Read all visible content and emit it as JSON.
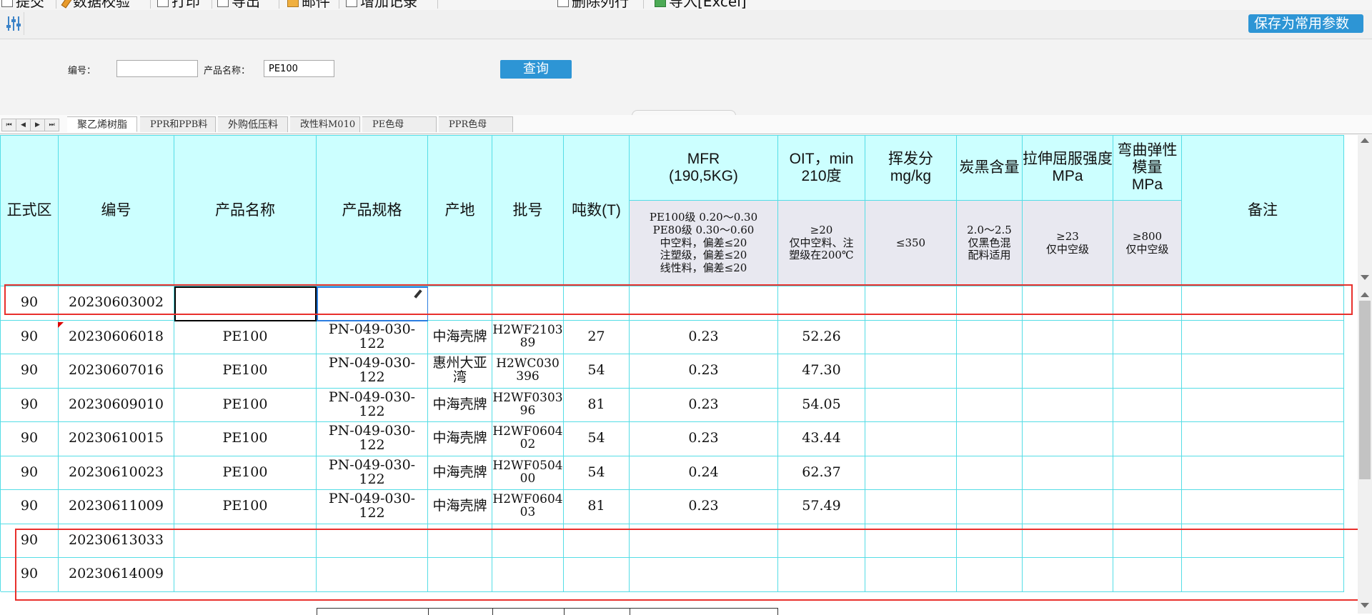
{
  "menubar": {
    "items": [
      "提交",
      "数据校验",
      "打印",
      "导出",
      "邮件",
      "增加记录",
      "删除列行",
      "导入[Excel]"
    ]
  },
  "toolbar": {
    "save_label": "保存为常用参数"
  },
  "search": {
    "code_label": "编号：",
    "code_value": "",
    "name_label": "产品名称：",
    "name_value": "PE100",
    "query_label": "查询"
  },
  "tabs": {
    "nav": [
      "⏮",
      "◀",
      "▶",
      "⏭"
    ],
    "sheets": [
      "聚乙烯树脂",
      "PPR和PPB料",
      "外购低压料",
      "改性料M010",
      "PE色母",
      "PPR色母"
    ],
    "active_index": 0
  },
  "table": {
    "headers": {
      "zone": "正式区",
      "code": "编号",
      "name": "产品名称",
      "spec": "产品规格",
      "origin": "产地",
      "batch": "批号",
      "tons": "吨数(T)",
      "mfr": "MFR\n(190,5KG)",
      "oit": "OIT，min\n210度",
      "volatile": "挥发分\nmg/kg",
      "carbon": "炭黑含量",
      "tensile": "拉伸屈服强度\nMPa",
      "flex": "弯曲弹性模量\nMPa",
      "note": "备注"
    },
    "standards": {
      "mfr": "PE100级 0.20～0.30\nPE80级 0.30～0.60\n中空料，偏差≤20\n注塑级，偏差≤20\n线性料，偏差≤20",
      "oit": "≥20\n仅中空料、注\n塑级在200℃",
      "volatile": "≤350",
      "carbon": "2.0～2.5\n仅黑色混\n配料适用",
      "tensile": "≥23\n仅中空级",
      "flex": "≥800\n仅中空级"
    },
    "rows": [
      {
        "zone": "90",
        "code": "20230603002",
        "name": "",
        "spec": "",
        "origin": "",
        "batch": "",
        "tons": "",
        "mfr": "",
        "oit": ""
      },
      {
        "zone": "90",
        "code": "20230606018",
        "name": "PE100",
        "spec": "PN-049-030-122",
        "origin": "中海壳牌",
        "batch": "H2WF210389",
        "tons": "27",
        "mfr": "0.23",
        "oit": "52.26"
      },
      {
        "zone": "90",
        "code": "20230607016",
        "name": "PE100",
        "spec": "PN-049-030-122",
        "origin": "惠州大亚湾",
        "batch": "H2WC030396",
        "tons": "54",
        "mfr": "0.23",
        "oit": "47.30"
      },
      {
        "zone": "90",
        "code": "20230609010",
        "name": "PE100",
        "spec": "PN-049-030-122",
        "origin": "中海壳牌",
        "batch": "H2WF030396",
        "tons": "81",
        "mfr": "0.23",
        "oit": "54.05"
      },
      {
        "zone": "90",
        "code": "20230610015",
        "name": "PE100",
        "spec": "PN-049-030-122",
        "origin": "中海壳牌",
        "batch": "H2WF060402",
        "tons": "54",
        "mfr": "0.23",
        "oit": "43.44"
      },
      {
        "zone": "90",
        "code": "20230610023",
        "name": "PE100",
        "spec": "PN-049-030-122",
        "origin": "中海壳牌",
        "batch": "H2WF050400",
        "tons": "54",
        "mfr": "0.24",
        "oit": "62.37"
      },
      {
        "zone": "90",
        "code": "20230611009",
        "name": "PE100",
        "spec": "PN-049-030-122",
        "origin": "中海壳牌",
        "batch": "H2WF060403",
        "tons": "81",
        "mfr": "0.23",
        "oit": "57.49"
      },
      {
        "zone": "90",
        "code": "20230613033",
        "name": "",
        "spec": "",
        "origin": "",
        "batch": "",
        "tons": "",
        "mfr": "",
        "oit": ""
      },
      {
        "zone": "90",
        "code": "20230614009",
        "name": "",
        "spec": "",
        "origin": "",
        "batch": "",
        "tons": "",
        "mfr": "",
        "oit": ""
      }
    ]
  },
  "colors": {
    "grid_line": "#55dde6",
    "header_bg": "#ccffff",
    "standard_bg": "#e8e8f0",
    "accent": "#2d95d5",
    "highlight_box": "#e8302c"
  }
}
